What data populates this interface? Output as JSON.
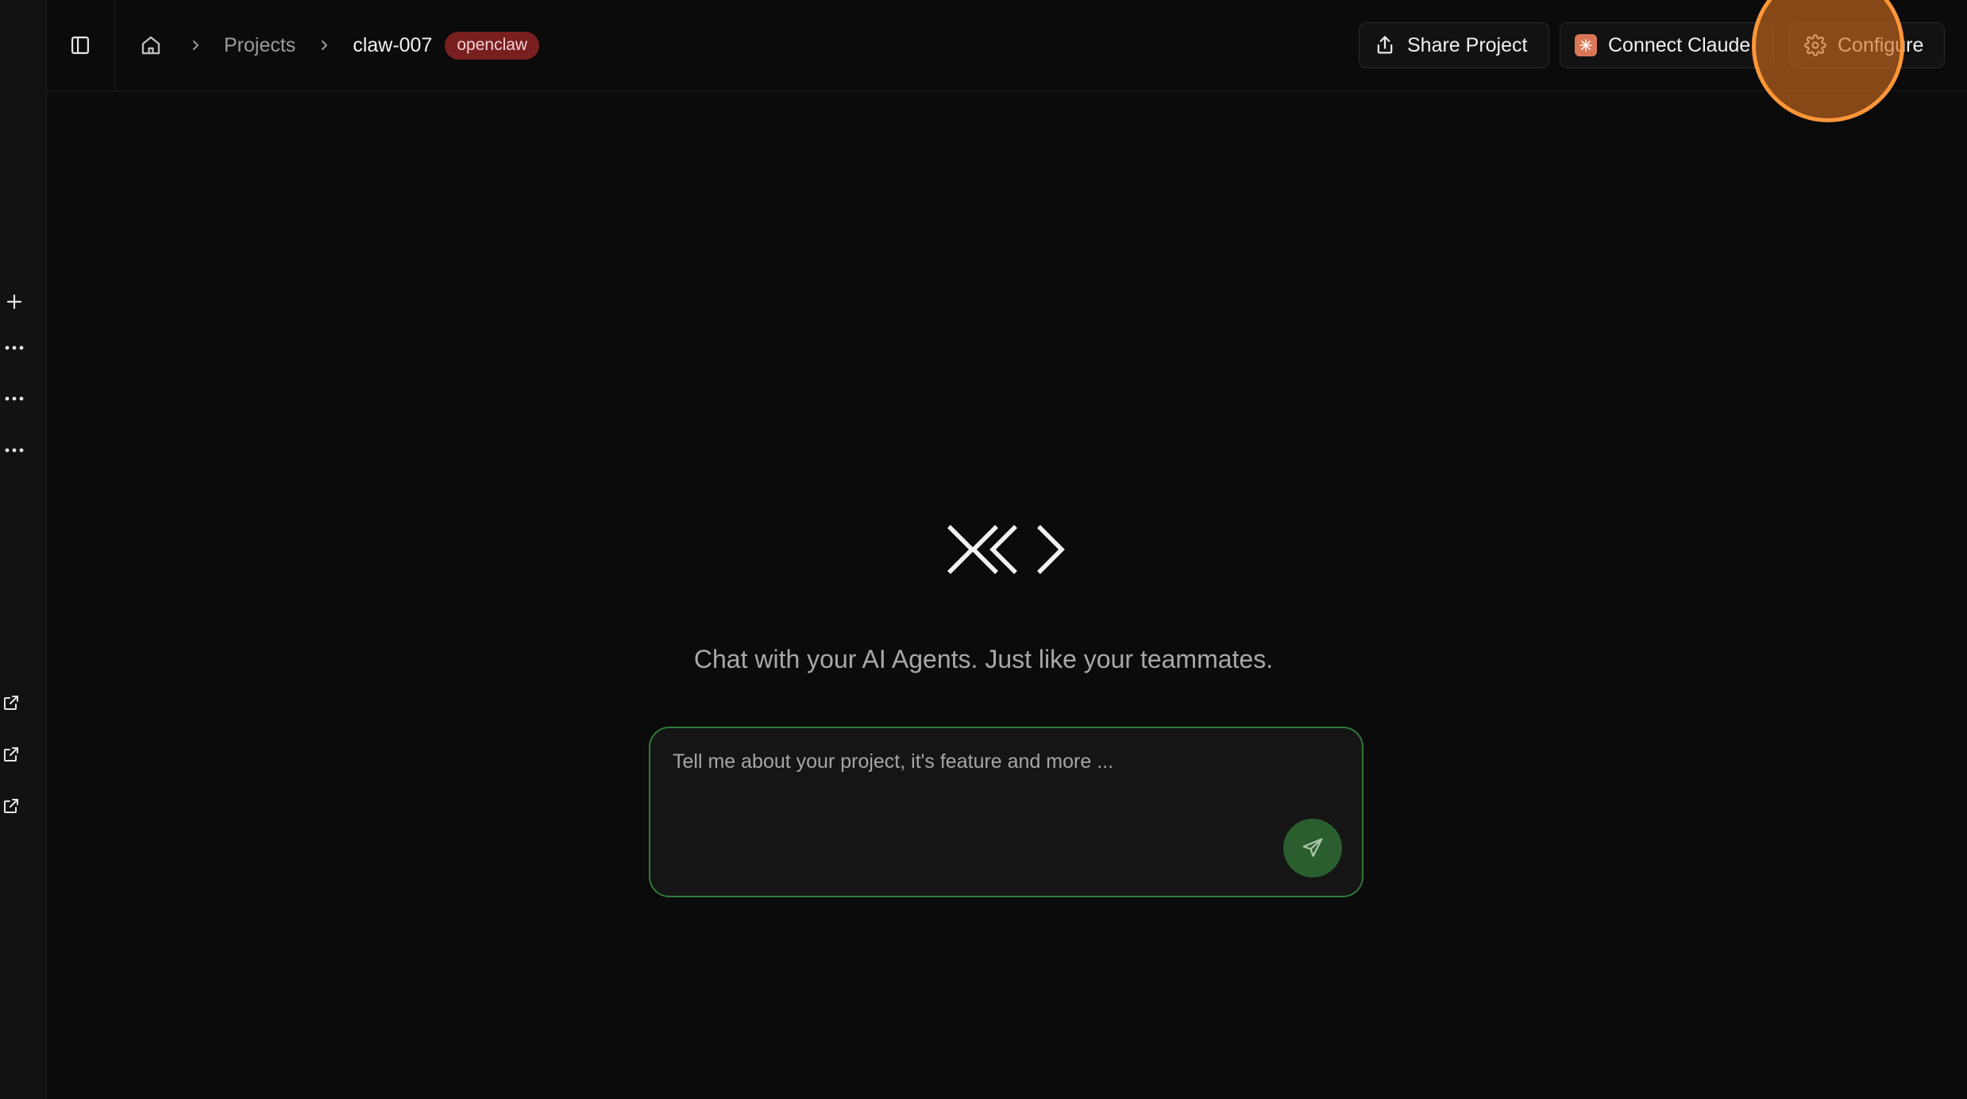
{
  "breadcrumb": {
    "projects_label": "Projects",
    "current_label": "claw-007",
    "badge_label": "openclaw"
  },
  "header": {
    "share_label": "Share Project",
    "connect_label": "Connect Claude",
    "configure_label": "Configure"
  },
  "main": {
    "tagline": "Chat with your AI Agents. Just like your teammates.",
    "composer_placeholder": "Tell me about your project, it's feature and more ..."
  },
  "icons": {
    "rail": [
      "plus-icon",
      "more-horizontal-icon",
      "more-horizontal-icon",
      "more-horizontal-icon",
      "external-link-icon",
      "external-link-icon",
      "external-link-icon"
    ],
    "header": [
      "sidebar-toggle-icon",
      "home-icon",
      "chevron-right-icon",
      "share-icon",
      "claude-logo-icon",
      "gear-icon"
    ],
    "composer": [
      "send-icon"
    ]
  },
  "colors": {
    "background": "#0b0b0b",
    "badge": "#7a1f1f",
    "composer_border": "#2f7a3a",
    "send_button": "#2b5e2f",
    "highlight": "#ff9638",
    "claude_brand": "#d97757"
  }
}
